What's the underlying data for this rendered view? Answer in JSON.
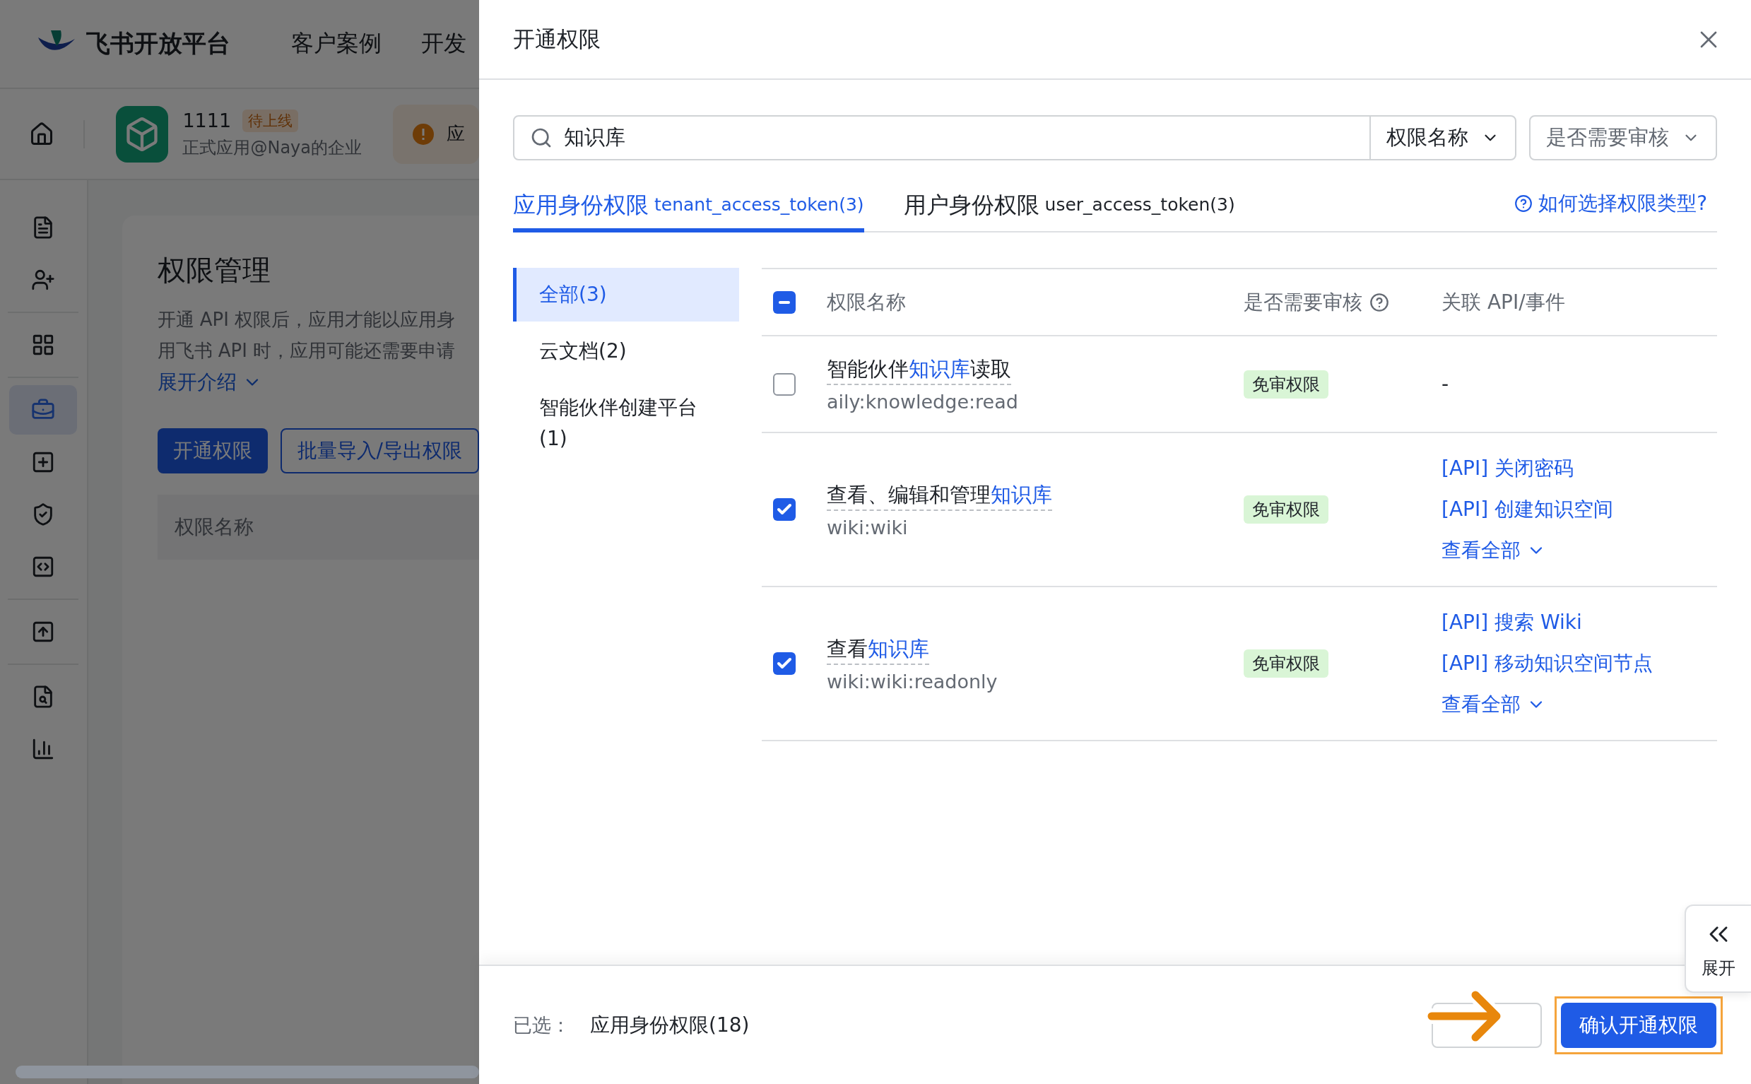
{
  "background": {
    "logo_text": "飞书开放平台",
    "nav": [
      "客户案例",
      "开发"
    ],
    "app": {
      "name": "1111",
      "status": "待上线",
      "subtitle": "正式应用@Naya的企业",
      "alert_text": "应"
    },
    "sidebar": [
      {
        "items": [
          {
            "kind": "doc",
            "selected": false
          },
          {
            "kind": "user-add",
            "selected": false
          }
        ]
      },
      {
        "items": [
          {
            "kind": "apps",
            "selected": false
          }
        ]
      },
      {
        "items": [
          {
            "kind": "bag",
            "selected": true
          },
          {
            "kind": "add",
            "selected": false
          },
          {
            "kind": "shield",
            "selected": false
          },
          {
            "kind": "code",
            "selected": false
          }
        ]
      },
      {
        "items": [
          {
            "kind": "upload",
            "selected": false
          }
        ]
      },
      {
        "items": [
          {
            "kind": "search-doc",
            "selected": false
          },
          {
            "kind": "chart",
            "selected": false
          }
        ]
      }
    ],
    "card": {
      "title": "权限管理",
      "description": [
        "开通 API 权限后，应用才能以应用身",
        "用飞书 API 时，应用可能还需要申请"
      ],
      "expand_link": "展开介绍",
      "buttons": [
        {
          "label": "开通权限",
          "kind": "primary"
        },
        {
          "label": "批量导入/导出权限",
          "kind": "outline"
        }
      ],
      "table_header": "权限名称"
    }
  },
  "drawer": {
    "title": "开通权限",
    "search": {
      "value": "知识库",
      "field_filter": "权限名称"
    },
    "filters": [
      "是否需要审核"
    ],
    "tabs": [
      {
        "label": "应用身份权限",
        "token": "tenant_access_token(3)",
        "selected": true
      },
      {
        "label": "用户身份权限",
        "token": "user_access_token(3)",
        "selected": false
      }
    ],
    "help_link": "如何选择权限类型?",
    "categories": [
      {
        "label": "全部(3)",
        "selected": true
      },
      {
        "label": "云文档(2)",
        "selected": false
      },
      {
        "label": "智能伙伴创建平台(1)",
        "selected": false
      }
    ],
    "table": {
      "header_checkbox": {
        "indeterminate": true
      },
      "columns": [
        "权限名称",
        "是否需要审核",
        "关联 API/事件"
      ],
      "rows": [
        {
          "checked": false,
          "name_parts": [
            {
              "text": "智能伙伴",
              "highlight": false
            },
            {
              "text": "知识库",
              "highlight": true
            },
            {
              "text": "读取",
              "highlight": false
            }
          ],
          "scope": "aily:knowledge:read",
          "review": "免审权限",
          "apis": [
            "-"
          ],
          "more": null
        },
        {
          "checked": true,
          "name_parts": [
            {
              "text": "查看、编辑和管理",
              "highlight": false
            },
            {
              "text": "知识库",
              "highlight": true
            }
          ],
          "scope": "wiki:wiki",
          "review": "免审权限",
          "apis": [
            "[API] 关闭密码",
            "[API] 创建知识空间"
          ],
          "more": "查看全部"
        },
        {
          "checked": true,
          "name_parts": [
            {
              "text": "查看",
              "highlight": false
            },
            {
              "text": "知识库",
              "highlight": true
            }
          ],
          "scope": "wiki:wiki:readonly",
          "review": "免审权限",
          "apis": [
            "[API] 搜索 Wiki",
            "[API] 移动知识空间节点"
          ],
          "more": "查看全部"
        }
      ]
    },
    "footer": {
      "selected_label": "已选：",
      "selected_value": "应用身份权限(18)",
      "confirm": "确认开通权限",
      "highlight": true
    },
    "expand_tab": "展开"
  }
}
